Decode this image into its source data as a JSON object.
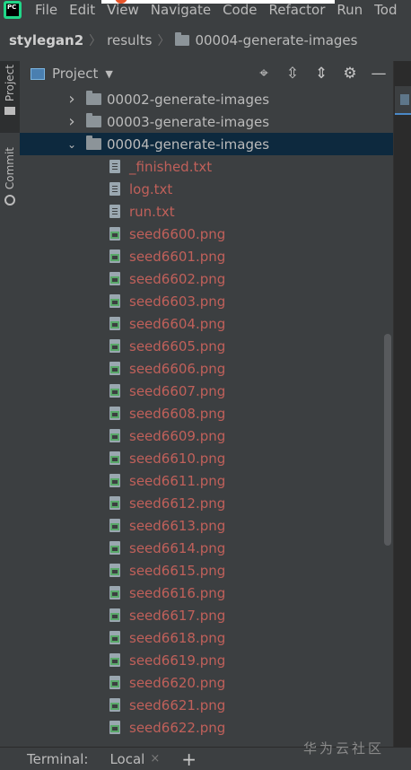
{
  "menubar": {
    "items": [
      {
        "label": "File"
      },
      {
        "label": "Edit"
      },
      {
        "label": "View"
      },
      {
        "label": "Navigate"
      },
      {
        "label": "Code"
      },
      {
        "label": "Refactor"
      },
      {
        "label": "Run"
      },
      {
        "label": "Tod"
      }
    ],
    "logo_text": "PC"
  },
  "breadcrumb": {
    "project": "stylegan2",
    "folder1": "results",
    "folder2": "00004-generate-images"
  },
  "toolstrip": {
    "project_label": "Project",
    "commit_label": "Commit"
  },
  "panel": {
    "title": "Project",
    "dropdown": "▼",
    "icons": [
      "locate-icon",
      "expand-all-icon",
      "collapse-all-icon",
      "gear-icon",
      "minimize-icon"
    ]
  },
  "tree": {
    "folders": [
      {
        "name": "00002-generate-images",
        "state": "collapsed"
      },
      {
        "name": "00003-generate-images",
        "state": "collapsed"
      },
      {
        "name": "00004-generate-images",
        "state": "expanded",
        "selected": true
      }
    ],
    "files": [
      {
        "name": "_finished.txt",
        "type": "txt"
      },
      {
        "name": "log.txt",
        "type": "txt"
      },
      {
        "name": "run.txt",
        "type": "txt"
      },
      {
        "name": "seed6600.png",
        "type": "png"
      },
      {
        "name": "seed6601.png",
        "type": "png"
      },
      {
        "name": "seed6602.png",
        "type": "png"
      },
      {
        "name": "seed6603.png",
        "type": "png"
      },
      {
        "name": "seed6604.png",
        "type": "png"
      },
      {
        "name": "seed6605.png",
        "type": "png"
      },
      {
        "name": "seed6606.png",
        "type": "png"
      },
      {
        "name": "seed6607.png",
        "type": "png"
      },
      {
        "name": "seed6608.png",
        "type": "png"
      },
      {
        "name": "seed6609.png",
        "type": "png"
      },
      {
        "name": "seed6610.png",
        "type": "png"
      },
      {
        "name": "seed6611.png",
        "type": "png"
      },
      {
        "name": "seed6612.png",
        "type": "png"
      },
      {
        "name": "seed6613.png",
        "type": "png"
      },
      {
        "name": "seed6614.png",
        "type": "png"
      },
      {
        "name": "seed6615.png",
        "type": "png"
      },
      {
        "name": "seed6616.png",
        "type": "png"
      },
      {
        "name": "seed6617.png",
        "type": "png"
      },
      {
        "name": "seed6618.png",
        "type": "png"
      },
      {
        "name": "seed6619.png",
        "type": "png"
      },
      {
        "name": "seed6620.png",
        "type": "png"
      },
      {
        "name": "seed6621.png",
        "type": "png"
      },
      {
        "name": "seed6622.png",
        "type": "png"
      }
    ]
  },
  "bottombar": {
    "terminal_label": "Terminal:",
    "tab_label": "Local",
    "close": "×",
    "add": "+"
  },
  "watermark": "华为云社区",
  "colors": {
    "selection": "#0d293e",
    "file_name": "#c0605a",
    "panel_bg": "#3c3f41"
  }
}
